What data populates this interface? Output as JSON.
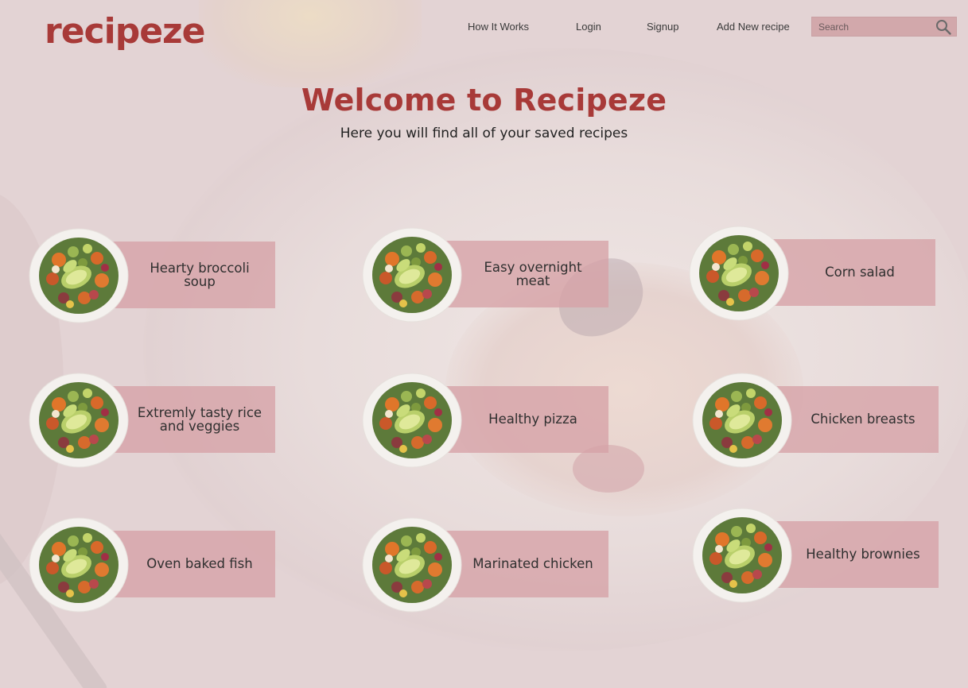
{
  "header": {
    "logo": "recipeze",
    "nav": {
      "how_it_works": "How It Works",
      "login": "Login",
      "signup": "Signup",
      "add_recipe": "Add New recipe"
    },
    "search": {
      "placeholder": "Search",
      "icon": "search-icon"
    }
  },
  "hero": {
    "title": "Welcome to Recipeze",
    "subtitle": "Here you will find all of your saved recipes"
  },
  "recipes": [
    {
      "title": "Hearty broccoli soup",
      "image": "salad-bowl-photo"
    },
    {
      "title": "Easy overnight meat",
      "image": "salad-bowl-photo"
    },
    {
      "title": "Corn salad",
      "image": "salad-bowl-photo"
    },
    {
      "title": "Extremly tasty rice and veggies",
      "image": "salad-bowl-photo"
    },
    {
      "title": "Healthy pizza",
      "image": "salad-bowl-photo"
    },
    {
      "title": "Chicken breasts",
      "image": "salad-bowl-photo"
    },
    {
      "title": "Oven baked fish",
      "image": "salad-bowl-photo"
    },
    {
      "title": "Marinated chicken",
      "image": "salad-bowl-photo"
    },
    {
      "title": "Healthy brownies",
      "image": "salad-bowl-photo"
    }
  ],
  "colors": {
    "brand": "#a83a38",
    "card": "#d6a2a6",
    "background": "#e3d3d4"
  }
}
